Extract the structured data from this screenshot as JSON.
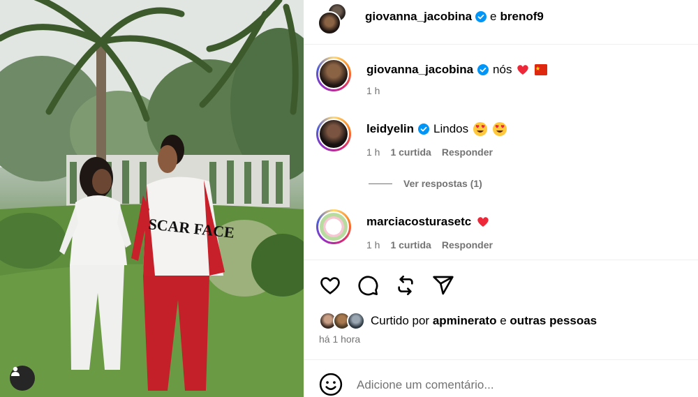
{
  "header": {
    "author": "giovanna_jacobina",
    "conjunction": "e",
    "collaborator": "brenof9"
  },
  "photo": {
    "jacket_text": "SCAR FACE"
  },
  "comments": [
    {
      "username": "giovanna_jacobina",
      "verified": true,
      "text": "nós",
      "emoji": [
        "heart",
        "flag-china"
      ],
      "time": "1 h",
      "likes": "",
      "reply": ""
    },
    {
      "username": "leidyelin",
      "verified": true,
      "text": "Lindos",
      "emoji": [
        "heart-eyes",
        "heart-eyes"
      ],
      "time": "1 h",
      "likes": "1 curtida",
      "reply": "Responder"
    },
    {
      "username": "marciacosturasetc",
      "verified": false,
      "text": "",
      "emoji": [
        "heart"
      ],
      "time": "1 h",
      "likes": "1 curtida",
      "reply": "Responder"
    }
  ],
  "view_replies": "Ver respostas (1)",
  "actions": {
    "icons": [
      "heart-icon",
      "comment-icon",
      "repost-icon",
      "share-icon"
    ]
  },
  "likes": {
    "prefix": "Curtido por",
    "user": "apminerato",
    "conjunction": "e",
    "others": "outras pessoas"
  },
  "time_ago": "há 1 hora",
  "add_comment": {
    "placeholder": "Adicione um comentário..."
  },
  "colors": {
    "verified": "#0095f6",
    "heart": "#ed2839",
    "meta": "#737373",
    "ring_start": "#feda75",
    "ring_end": "#4f5bd5"
  }
}
